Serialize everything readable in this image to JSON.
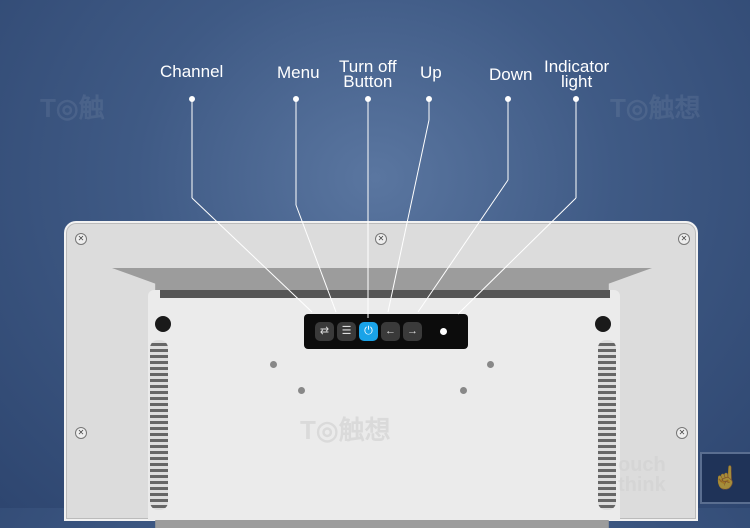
{
  "callouts": [
    {
      "id": "channel",
      "label": "Channel"
    },
    {
      "id": "menu",
      "label": "Menu"
    },
    {
      "id": "power",
      "label": "Turn off\nButton",
      "line1": "Turn off",
      "line2": "Button"
    },
    {
      "id": "up",
      "label": "Up"
    },
    {
      "id": "down",
      "label": "Down"
    },
    {
      "id": "indicator",
      "label": "Indicator\nlight",
      "line1": "Indicator",
      "line2": "light"
    }
  ],
  "control_panel": {
    "buttons": [
      {
        "name": "channel-button",
        "icon": "swap-arrows-icon",
        "glyph": "⇄"
      },
      {
        "name": "menu-button",
        "icon": "list-icon",
        "glyph": "☰"
      },
      {
        "name": "power-button",
        "icon": "power-icon",
        "glyph": "⏻"
      },
      {
        "name": "up-button",
        "icon": "arrow-left-icon",
        "glyph": "←"
      },
      {
        "name": "down-button",
        "icon": "arrow-right-icon",
        "glyph": "→"
      }
    ],
    "indicator": "indicator-light"
  },
  "colors": {
    "background": "#3f5a85",
    "power_button": "#1aa3e8",
    "panel": "#0c0c0c",
    "housing": "#dcdcdc"
  },
  "watermarks": {
    "brand": "Touch think",
    "logo": "touch-hand-icon"
  },
  "brand_corner": {
    "line1": "ouch",
    "line2": "think"
  }
}
